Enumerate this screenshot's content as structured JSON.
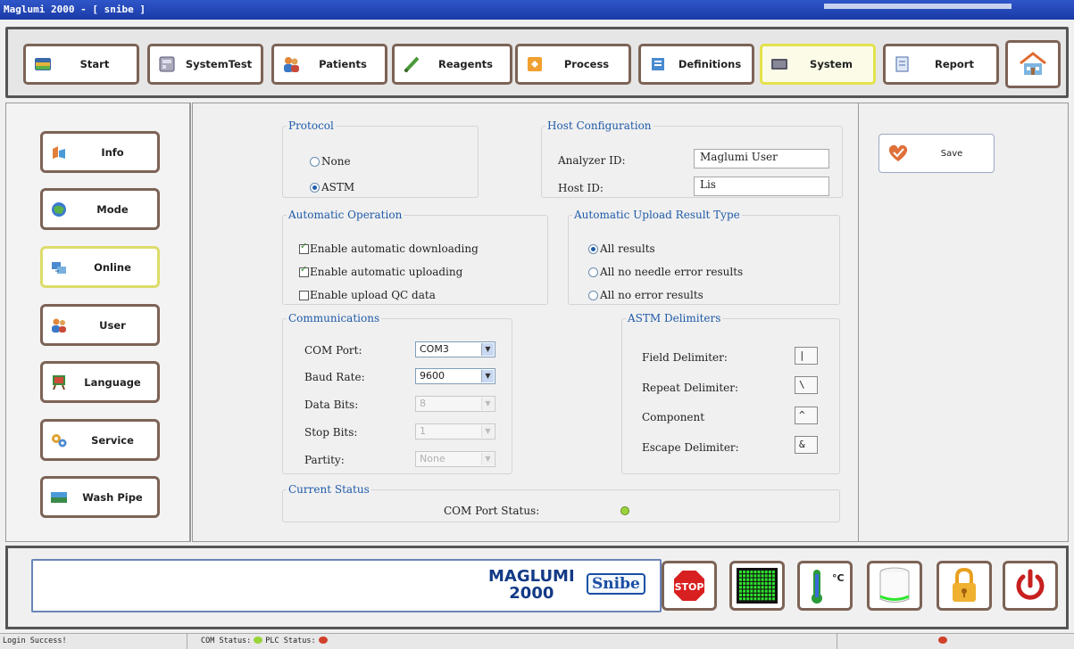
{
  "window": {
    "title": "Maglumi 2000 - [ snibe ]"
  },
  "toolbar": {
    "items": [
      {
        "label": "Start",
        "icon": "start-icon"
      },
      {
        "label": "SystemTest",
        "icon": "systemtest-icon"
      },
      {
        "label": "Patients",
        "icon": "patients-icon"
      },
      {
        "label": "Reagents",
        "icon": "reagents-icon"
      },
      {
        "label": "Process",
        "icon": "process-icon"
      },
      {
        "label": "Definitions",
        "icon": "definitions-icon"
      },
      {
        "label": "System",
        "icon": "system-icon",
        "active": true
      },
      {
        "label": "Report",
        "icon": "report-icon"
      }
    ],
    "home_icon": "home-icon"
  },
  "sidebar": {
    "items": [
      {
        "label": "Info",
        "icon": "info-icon"
      },
      {
        "label": "Mode",
        "icon": "mode-icon"
      },
      {
        "label": "Online",
        "icon": "online-icon",
        "active": true
      },
      {
        "label": "User",
        "icon": "user-icon"
      },
      {
        "label": "Language",
        "icon": "language-icon"
      },
      {
        "label": "Service",
        "icon": "service-icon"
      },
      {
        "label": "Wash Pipe",
        "icon": "wash-pipe-icon"
      }
    ]
  },
  "protocol": {
    "legend": "Protocol",
    "options": [
      {
        "label": "None",
        "selected": false
      },
      {
        "label": "ASTM",
        "selected": true
      }
    ]
  },
  "host_config": {
    "legend": "Host Configuration",
    "analyzer_id_label": "Analyzer ID:",
    "analyzer_id_value": "Maglumi User",
    "host_id_label": "Host ID:",
    "host_id_value": "Lis"
  },
  "auto_operation": {
    "legend": "Automatic Operation",
    "options": [
      {
        "label": "Enable automatic downloading",
        "checked": true
      },
      {
        "label": "Enable automatic uploading",
        "checked": true
      },
      {
        "label": "Enable upload QC data",
        "checked": false
      }
    ]
  },
  "upload_result": {
    "legend": "Automatic Upload Result Type",
    "options": [
      {
        "label": "All results",
        "selected": true
      },
      {
        "label": "All no needle error results",
        "selected": false
      },
      {
        "label": "All no error results",
        "selected": false
      }
    ]
  },
  "communications": {
    "legend": "Communications",
    "fields": [
      {
        "label": "COM Port:",
        "value": "COM3",
        "enabled": true
      },
      {
        "label": "Baud Rate:",
        "value": "9600",
        "enabled": true
      },
      {
        "label": "Data Bits:",
        "value": "8",
        "enabled": false
      },
      {
        "label": "Stop Bits:",
        "value": "1",
        "enabled": false
      },
      {
        "label": "Partity:",
        "value": "None",
        "enabled": false
      }
    ]
  },
  "astm_delimiters": {
    "legend": "ASTM Delimiters",
    "fields": [
      {
        "label": "Field Delimiter:",
        "value": "|"
      },
      {
        "label": "Repeat Delimiter:",
        "value": "\\"
      },
      {
        "label": "Component",
        "value": "^"
      },
      {
        "label": "Escape Delimiter:",
        "value": "&"
      }
    ]
  },
  "current_status": {
    "legend": "Current Status",
    "com_port_status_label": "COM Port Status:",
    "com_port_status_color": "#9bd43a"
  },
  "actions": {
    "save_label": "Save"
  },
  "bottom": {
    "logo_line1": "MAGLUMI",
    "logo_line2": "2000",
    "logo_brand": "Snibe",
    "stop_label": "STOP",
    "temp_unit": "°C"
  },
  "statusbar": {
    "message": "Login Success!",
    "com_status_label": "COM Status:",
    "com_status_color": "#9bd43a",
    "plc_status_label": "PLC Status:",
    "plc_status_color": "#d0402a",
    "right_indicator_color": "#d0402a"
  }
}
